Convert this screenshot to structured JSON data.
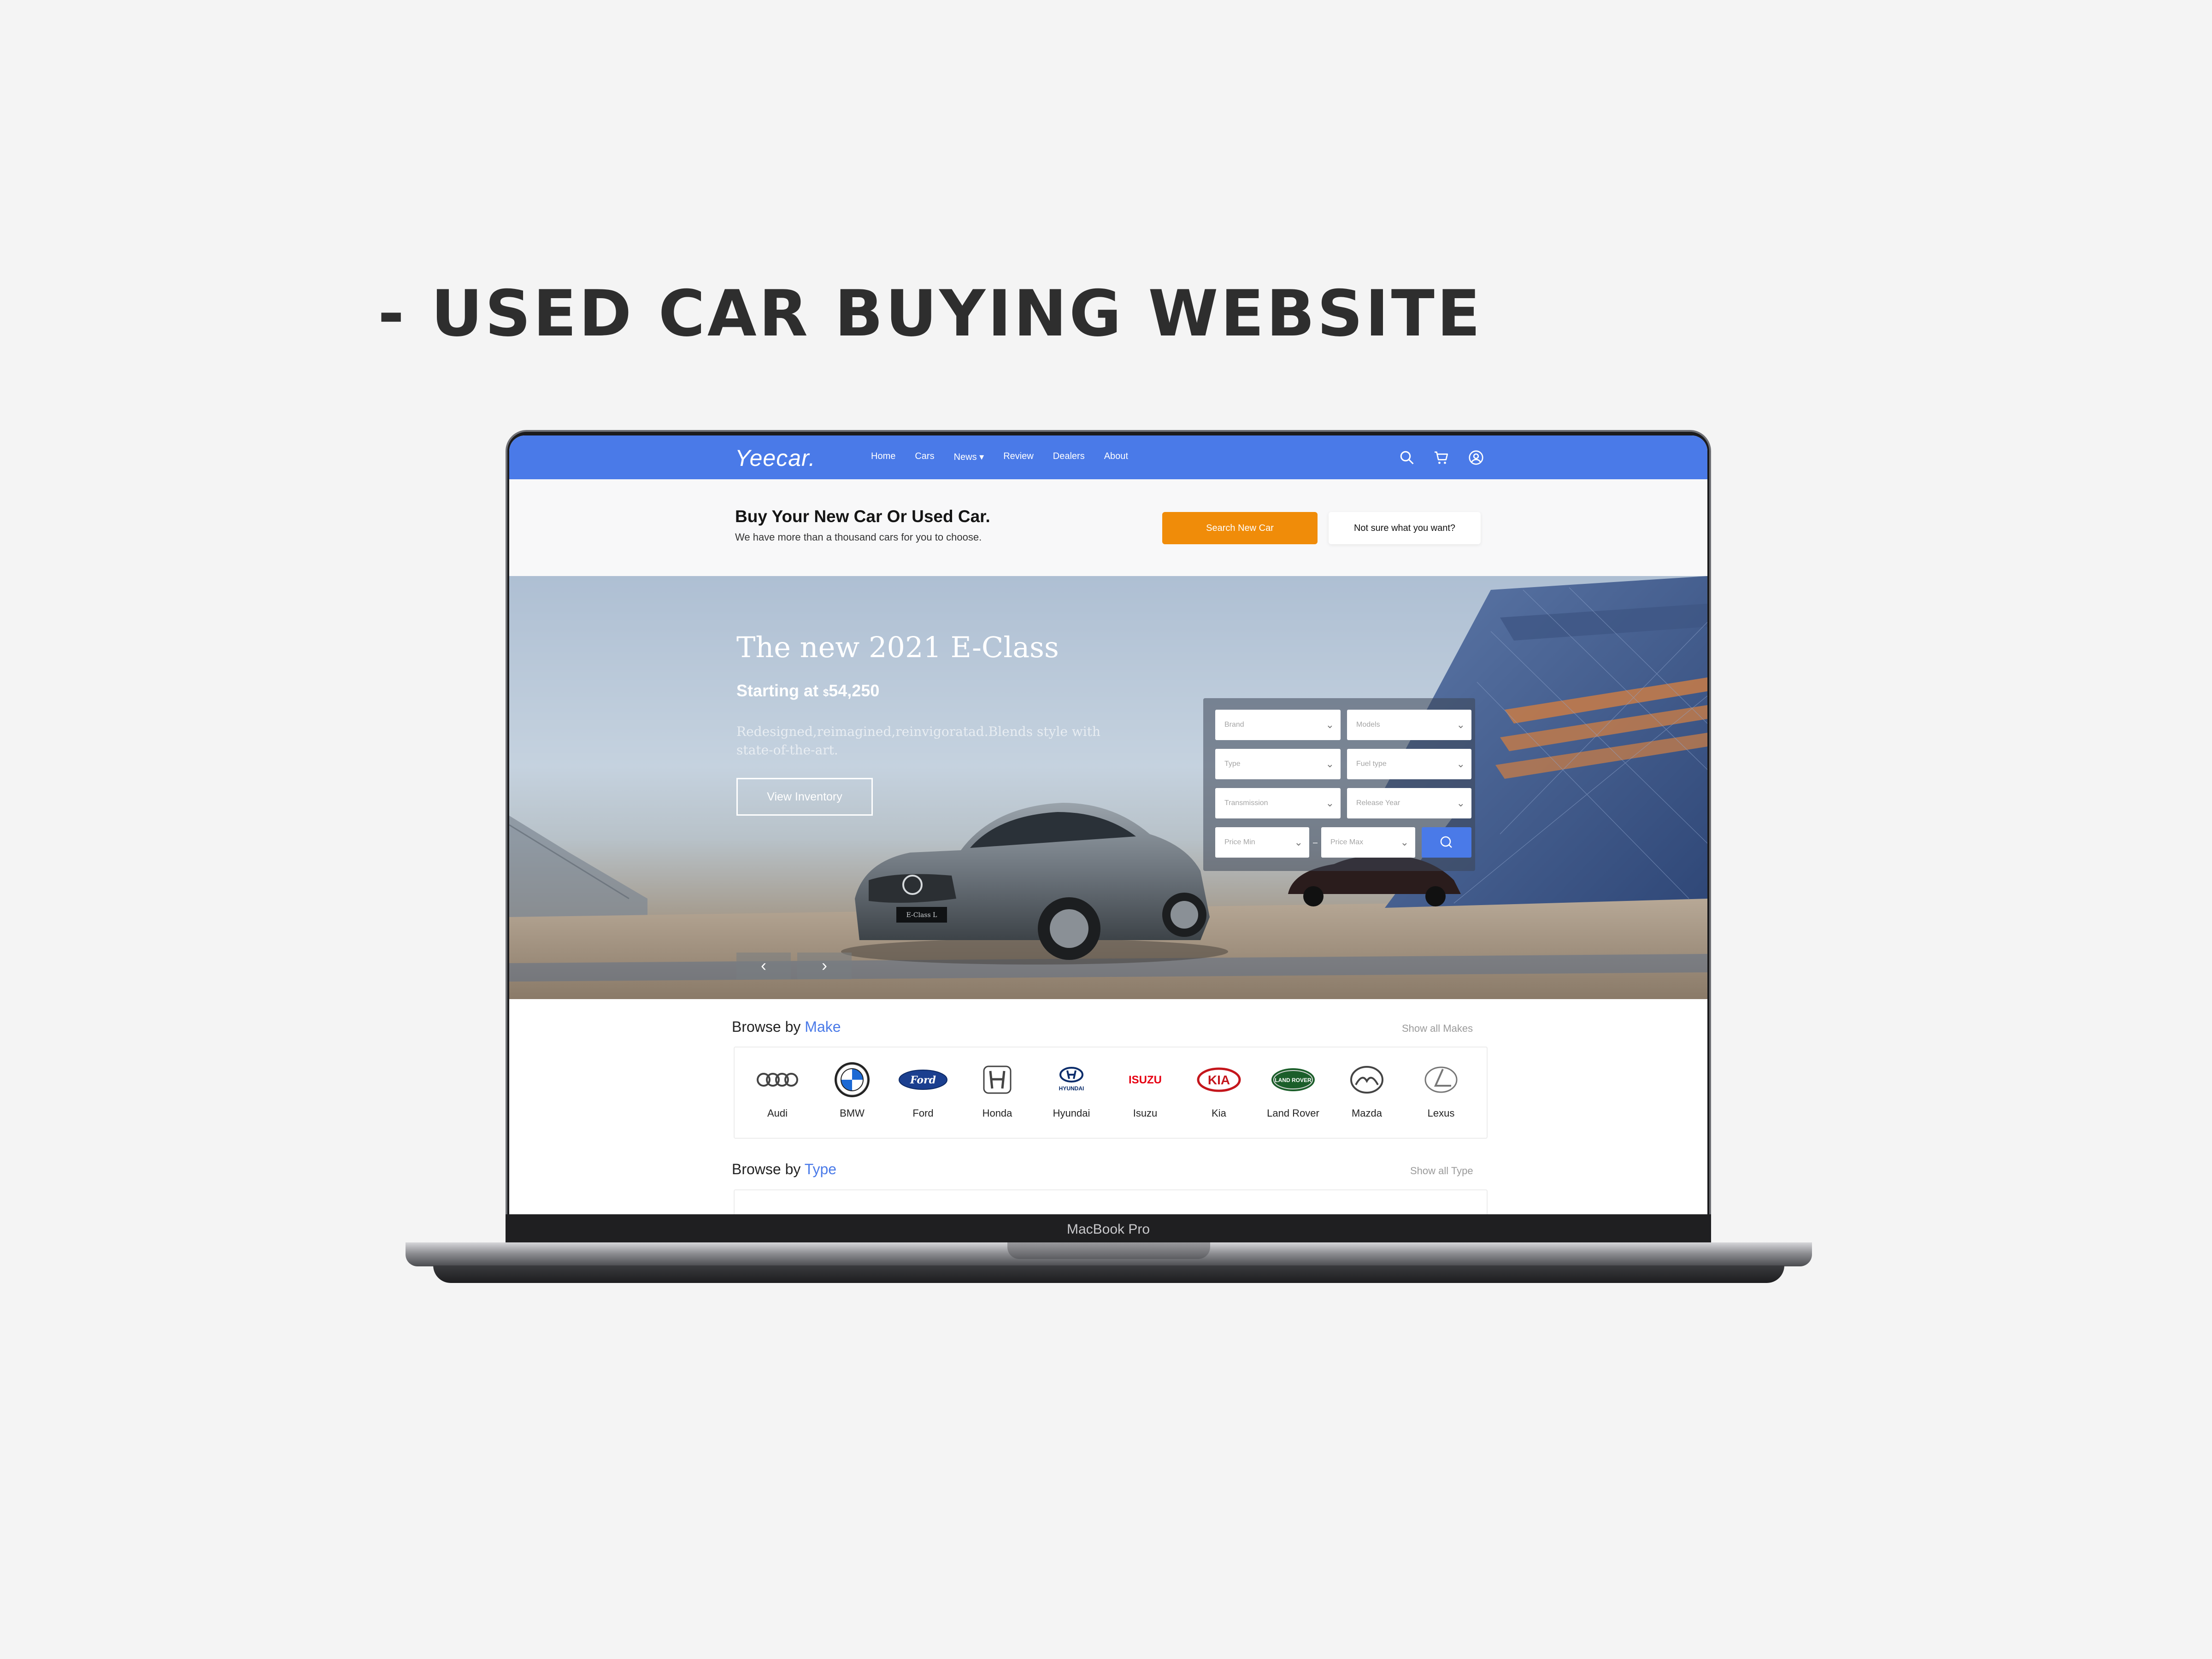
{
  "heading": "- USED CAR BUYING WEBSITE",
  "laptop_label": "MacBook Pro",
  "site": {
    "logo": "Yeecar.",
    "nav": [
      "Home",
      "Cars",
      "News ▾",
      "Review",
      "Dealers",
      "About"
    ],
    "icons": [
      "search-icon",
      "cart-icon",
      "user-icon"
    ]
  },
  "promo": {
    "title": "Buy Your New Car Or Used Car.",
    "subtitle": "We have more than a thousand cars for you to choose.",
    "primary_button": "Search New Car",
    "secondary_button": "Not sure what you want?"
  },
  "hero": {
    "title": "The new 2021 E-Class",
    "price_prefix": "Starting at ",
    "currency": "$",
    "price": "54,250",
    "description": "Redesigned,reimagined,reinvigoratad.Blends style with state-of-the-art.",
    "cta": "View Inventory",
    "plate": "E-Class L",
    "prev": "‹",
    "next": "›"
  },
  "filters": {
    "brand": "Brand",
    "models": "Models",
    "type": "Type",
    "fuel": "Fuel type",
    "transmission": "Transmission",
    "release_year": "Release Year",
    "price_min": "Price Min",
    "price_max": "Price Max",
    "dash": "–"
  },
  "browse_make": {
    "prefix": "Browse by ",
    "accent": "Make",
    "show_all": "Show all Makes",
    "makes": [
      "Audi",
      "BMW",
      "Ford",
      "Honda",
      "Hyundai",
      "Isuzu",
      "Kia",
      "Land Rover",
      "Mazda",
      "Lexus"
    ],
    "logo_texts": {
      "ford": "Ford",
      "hyundai": "HYUNDAI",
      "isuzu": "ISUZU",
      "kia": "KIA",
      "landrover": "LAND ROVER"
    }
  },
  "browse_type": {
    "prefix": "Browse by ",
    "accent": "Type",
    "show_all": "Show all Type"
  },
  "colors": {
    "brand_blue": "#4a7ae8",
    "orange": "#f08c09"
  }
}
